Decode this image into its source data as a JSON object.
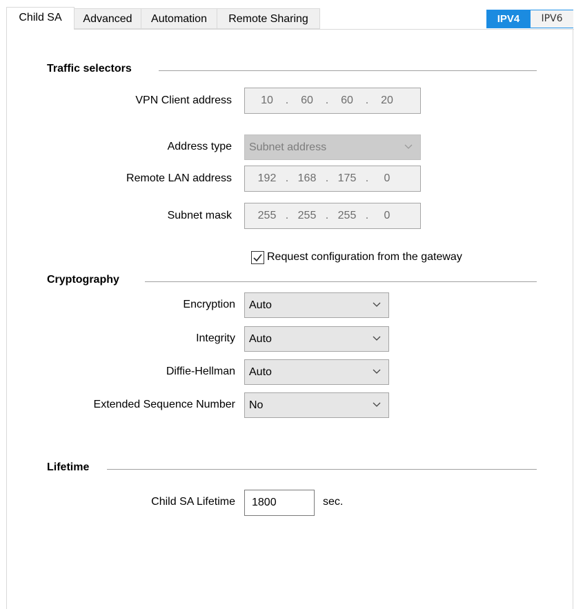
{
  "tabs": [
    {
      "label": "Child SA",
      "active": true
    },
    {
      "label": "Advanced",
      "active": false
    },
    {
      "label": "Automation",
      "active": false
    },
    {
      "label": "Remote Sharing",
      "active": false
    }
  ],
  "ip_toggle": {
    "ipv4": "IPV4",
    "ipv6": "IPV6",
    "selected": "IPV4",
    "accent": "#1b8be0"
  },
  "traffic": {
    "title": "Traffic selectors",
    "vpn_client_label": "VPN Client address",
    "vpn_client_octets": [
      "10",
      "60",
      "60",
      "20"
    ],
    "address_type_label": "Address type",
    "address_type_value": "Subnet address",
    "remote_lan_label": "Remote LAN address",
    "remote_lan_octets": [
      "192",
      "168",
      "175",
      "0"
    ],
    "subnet_mask_label": "Subnet mask",
    "subnet_mask_octets": [
      "255",
      "255",
      "255",
      "0"
    ],
    "request_config_label": "Request configuration from the gateway",
    "request_config_checked": true
  },
  "crypto": {
    "title": "Cryptography",
    "encryption_label": "Encryption",
    "encryption_value": "Auto",
    "integrity_label": "Integrity",
    "integrity_value": "Auto",
    "dh_label": "Diffie-Hellman",
    "dh_value": "Auto",
    "esn_label": "Extended Sequence Number",
    "esn_value": "No"
  },
  "lifetime": {
    "title": "Lifetime",
    "child_sa_label": "Child SA Lifetime",
    "child_sa_value": "1800",
    "unit": "sec."
  },
  "icons": {
    "dropdown": "chevron-down-icon",
    "check": "checkmark-icon"
  }
}
